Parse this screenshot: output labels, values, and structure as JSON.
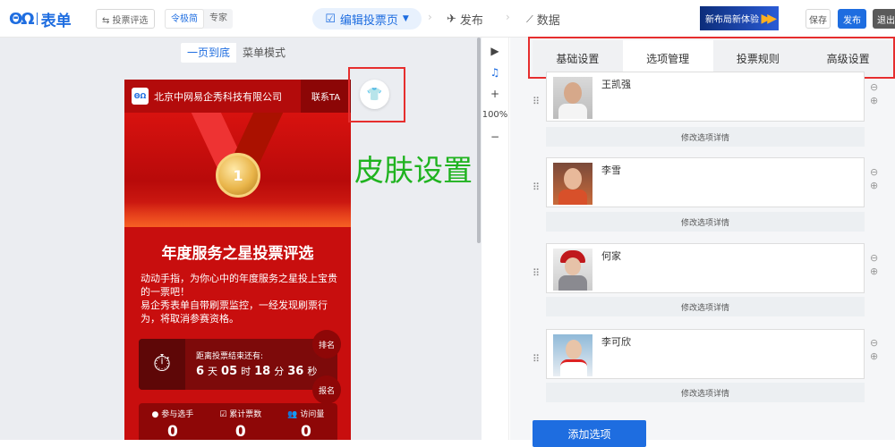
{
  "app": {
    "logo_mark": "ΘΩ",
    "logo_name": "表单"
  },
  "toolbar": {
    "switch_label": "⇆ 投票评选",
    "modes": [
      "令极简",
      "专家"
    ],
    "step_edit": "编辑投票页",
    "step_publish": "发布",
    "step_data": "数据",
    "banner_text": "新布局新体验",
    "save": "保存",
    "publish": "发布",
    "exit": "退出"
  },
  "canvas": {
    "toggle": [
      "一页到底",
      "菜单模式"
    ],
    "skin_annotation": "皮肤设置"
  },
  "phone": {
    "company": "北京中网易企秀科技有限公司",
    "contact": "联系TA",
    "logo_text": "ΘΩ",
    "medal_number": "1",
    "title": "年度服务之星投票评选",
    "desc_1": "动动手指，为你心中的年度服务之星投上宝贵的一票吧！",
    "desc_2": "易企秀表单自带刷票监控，一经发现刷票行为，将取消参赛资格。",
    "countdown_label": "距离投票结束还有:",
    "cd_days": "6",
    "cd_days_unit": "天",
    "cd_hours": "05",
    "cd_hours_unit": "时",
    "cd_minutes": "18",
    "cd_minutes_unit": "分",
    "cd_seconds": "36",
    "cd_seconds_unit": "秒",
    "rank": "排名",
    "signup": "报名",
    "stats": [
      {
        "label": "参与选手",
        "value": "0"
      },
      {
        "label": "累计票数",
        "value": "0"
      },
      {
        "label": "访问量",
        "value": "0"
      }
    ]
  },
  "tools": {
    "zoom": "100%"
  },
  "panel": {
    "tabs": [
      "基础设置",
      "选项管理",
      "投票规则",
      "高级设置"
    ],
    "active_tab": "选项管理",
    "options": [
      {
        "name": "王凯强",
        "detail": "修改选项详情"
      },
      {
        "name": "李雪",
        "detail": "修改选项详情"
      },
      {
        "name": "何家",
        "detail": "修改选项详情"
      },
      {
        "name": "李可欣",
        "detail": "修改选项详情"
      }
    ],
    "add_option": "添加选项"
  },
  "colors": {
    "accent": "#1e6de0",
    "annotation_red": "#e62e2e",
    "annotation_green": "#1fb31f",
    "phone_red": "#c80e0e"
  }
}
